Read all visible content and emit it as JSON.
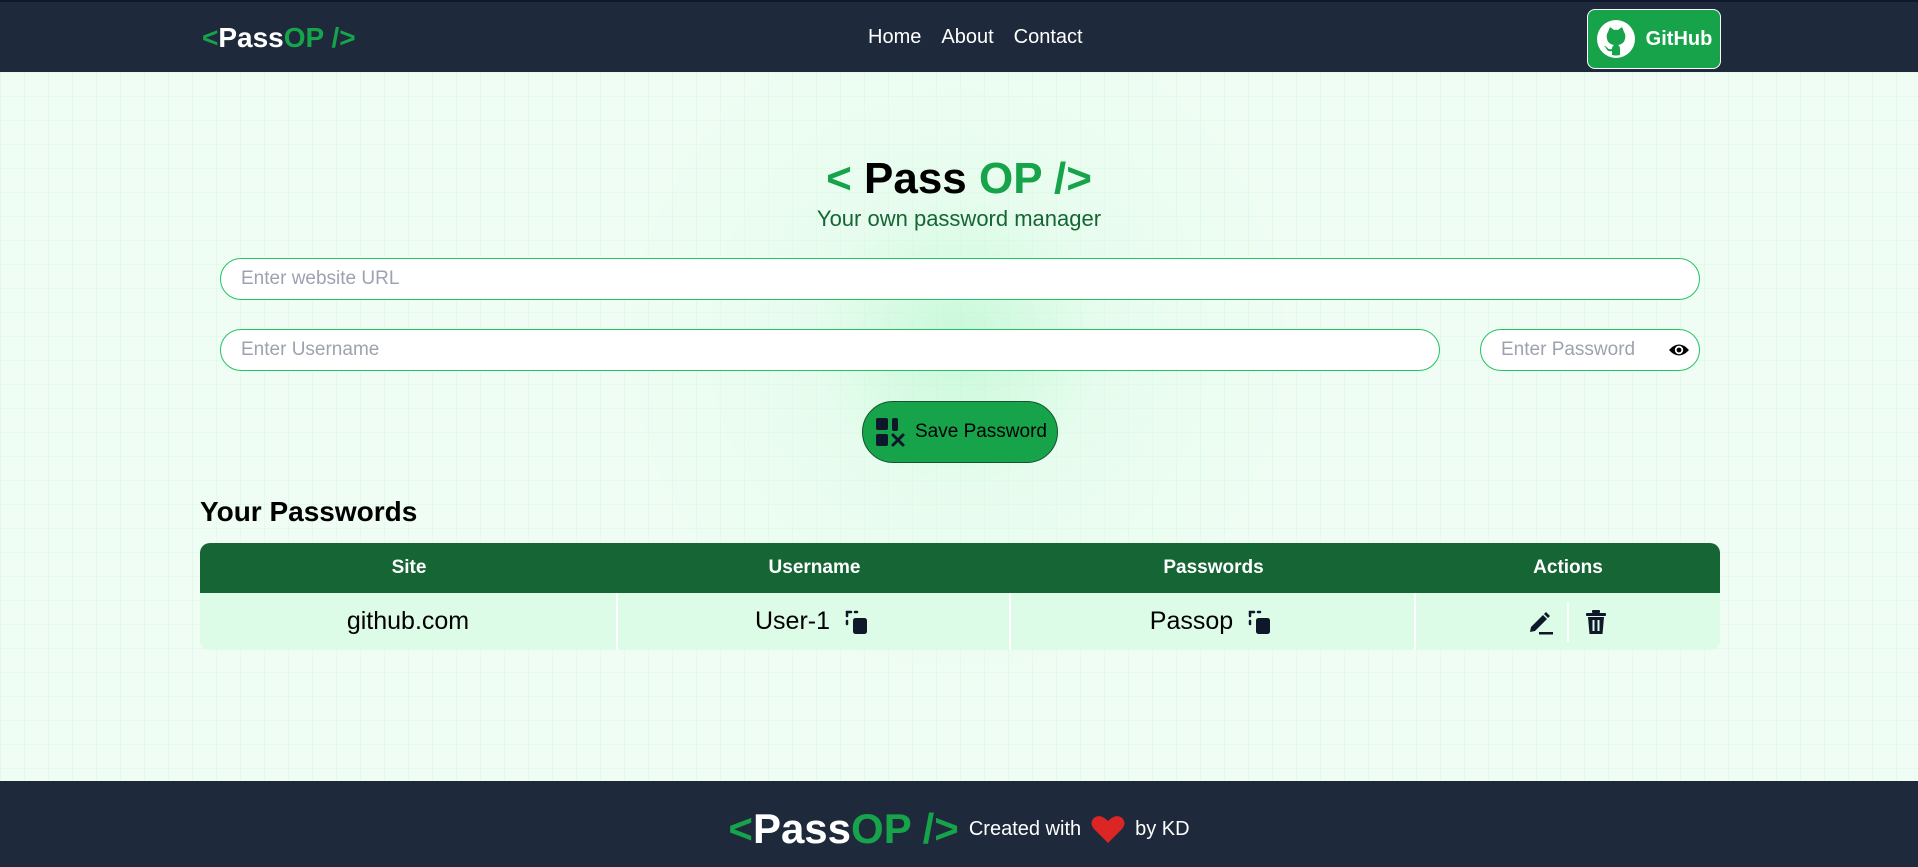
{
  "nav": {
    "logo": {
      "open": "<",
      "pass": "Pass",
      "op": "OP",
      "close": " />"
    },
    "links": [
      "Home",
      "About",
      "Contact"
    ],
    "github_label": "GitHub",
    "github_icon": "github-icon"
  },
  "hero": {
    "title": {
      "open": "< ",
      "pass": "Pass ",
      "op": "OP",
      "close": " />"
    },
    "subtitle": "Your own password manager"
  },
  "form": {
    "url_placeholder": "Enter website URL",
    "username_placeholder": "Enter Username",
    "password_placeholder": "Enter Password",
    "save_label": "Save Password"
  },
  "passwords": {
    "heading": "Your Passwords",
    "columns": [
      "Site",
      "Username",
      "Passwords",
      "Actions"
    ],
    "rows": [
      {
        "site": "github.com",
        "username": "User-1",
        "password": "Passop"
      }
    ]
  },
  "footer": {
    "logo": {
      "open": "<",
      "pass": "Pass",
      "op": "OP",
      "close": " />"
    },
    "created": "Created with",
    "by": "by KD"
  },
  "colors": {
    "nav_bg": "#1e293b",
    "accent": "#16a34a",
    "table_header": "#166534",
    "table_row": "#dcfce7",
    "heart": "#dc2626"
  }
}
